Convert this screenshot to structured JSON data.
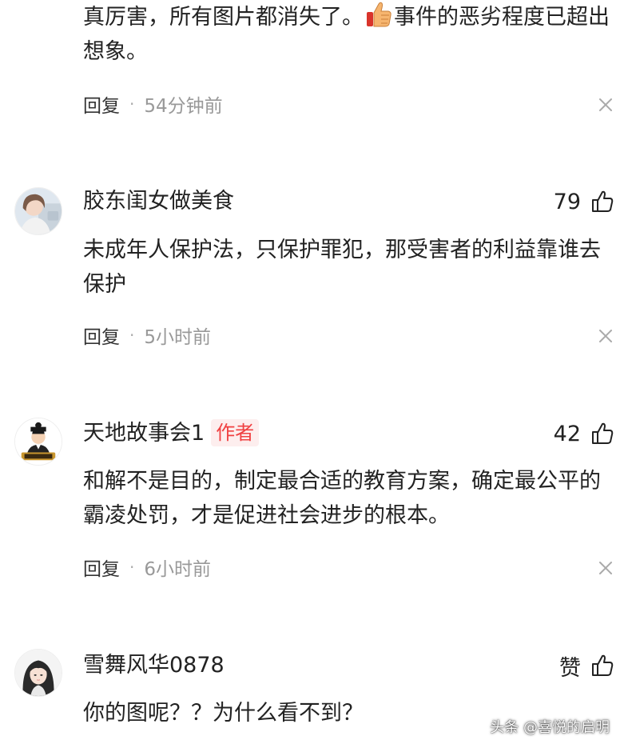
{
  "comments": [
    {
      "text_before_emoji": "真厉害，所有图片都消失了。",
      "emoji": "thumbs-up-emoji",
      "text_after_emoji": "事件的恶劣程度已超出想象。",
      "reply_label": "回复",
      "separator": "·",
      "time": "54分钟前",
      "close_icon": "close-icon"
    },
    {
      "username": "胶东闺女做美食",
      "like_count": "79",
      "text": "未成年人保护法，只保护罪犯，那受害者的利益靠谁去保护",
      "reply_label": "回复",
      "separator": "·",
      "time": "5小时前",
      "avatar": "user-photo-avatar",
      "close_icon": "close-icon"
    },
    {
      "username": "天地故事会1",
      "badge": "作者",
      "like_count": "42",
      "text": "和解不是目的，制定最合适的教育方案，确定最公平的霸凌处罚，才是促进社会进步的根本。",
      "reply_label": "回复",
      "separator": "·",
      "time": "6小时前",
      "avatar": "cartoon-scholar-avatar",
      "close_icon": "close-icon"
    },
    {
      "username": "雪舞风华0878",
      "like_label": "赞",
      "text": "你的图呢？？为什么看不到？",
      "avatar": "illustrated-girl-avatar"
    }
  ],
  "watermark": "头条 @喜悦的启明",
  "colors": {
    "text": "#222222",
    "meta_text": "#999999",
    "author_badge_bg": "#fdeeee",
    "author_badge_text": "#f04142"
  }
}
